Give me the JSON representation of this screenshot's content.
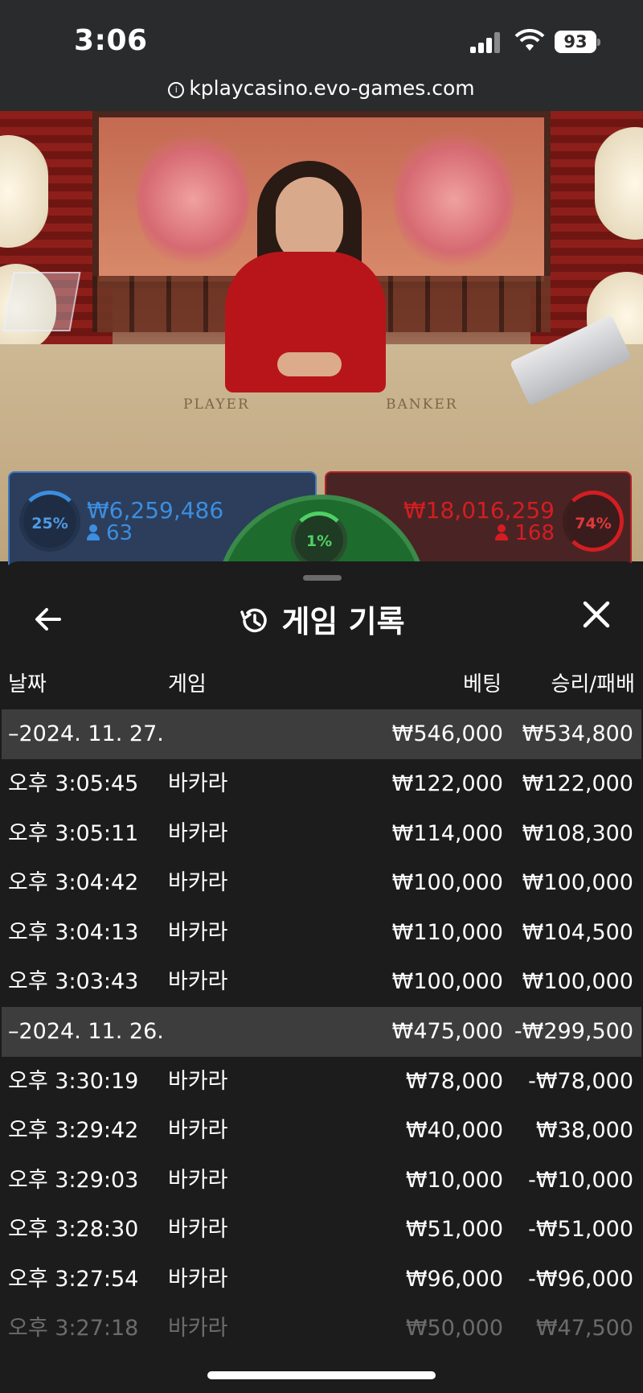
{
  "status_bar": {
    "time": "3:06",
    "battery": "93",
    "url": "kplaycasino.evo-games.com"
  },
  "stream": {
    "table_labels": {
      "player": "PLAYER",
      "banker": "BANKER"
    },
    "player": {
      "percent": "25%",
      "amount": "₩6,259,486",
      "count": "63"
    },
    "banker": {
      "percent": "74%",
      "amount": "₩18,016,259",
      "count": "168"
    },
    "tie": {
      "percent": "1%"
    }
  },
  "history": {
    "title": "게임 기록",
    "icons": {
      "back": "arrow-left-icon",
      "history": "history-icon",
      "close": "close-icon"
    },
    "columns": {
      "date": "날짜",
      "game": "게임",
      "bet": "베팅",
      "result": "승리/패배"
    },
    "groups": [
      {
        "date": "–2024. 11. 27.",
        "bet": "₩546,000",
        "result": "₩534,800",
        "rows": [
          {
            "time": "오후 3:05:45",
            "game": "바카라",
            "bet": "₩122,000",
            "result": "₩122,000"
          },
          {
            "time": "오후 3:05:11",
            "game": "바카라",
            "bet": "₩114,000",
            "result": "₩108,300"
          },
          {
            "time": "오후 3:04:42",
            "game": "바카라",
            "bet": "₩100,000",
            "result": "₩100,000"
          },
          {
            "time": "오후 3:04:13",
            "game": "바카라",
            "bet": "₩110,000",
            "result": "₩104,500"
          },
          {
            "time": "오후 3:03:43",
            "game": "바카라",
            "bet": "₩100,000",
            "result": "₩100,000"
          }
        ]
      },
      {
        "date": "–2024. 11. 26.",
        "bet": "₩475,000",
        "result": "-₩299,500",
        "rows": [
          {
            "time": "오후 3:30:19",
            "game": "바카라",
            "bet": "₩78,000",
            "result": "-₩78,000"
          },
          {
            "time": "오후 3:29:42",
            "game": "바카라",
            "bet": "₩40,000",
            "result": "₩38,000"
          },
          {
            "time": "오후 3:29:03",
            "game": "바카라",
            "bet": "₩10,000",
            "result": "-₩10,000"
          },
          {
            "time": "오후 3:28:30",
            "game": "바카라",
            "bet": "₩51,000",
            "result": "-₩51,000"
          },
          {
            "time": "오후 3:27:54",
            "game": "바카라",
            "bet": "₩96,000",
            "result": "-₩96,000"
          },
          {
            "time": "오후 3:27:18",
            "game": "바카라",
            "bet": "₩50,000",
            "result": "₩47,500"
          }
        ]
      }
    ]
  }
}
